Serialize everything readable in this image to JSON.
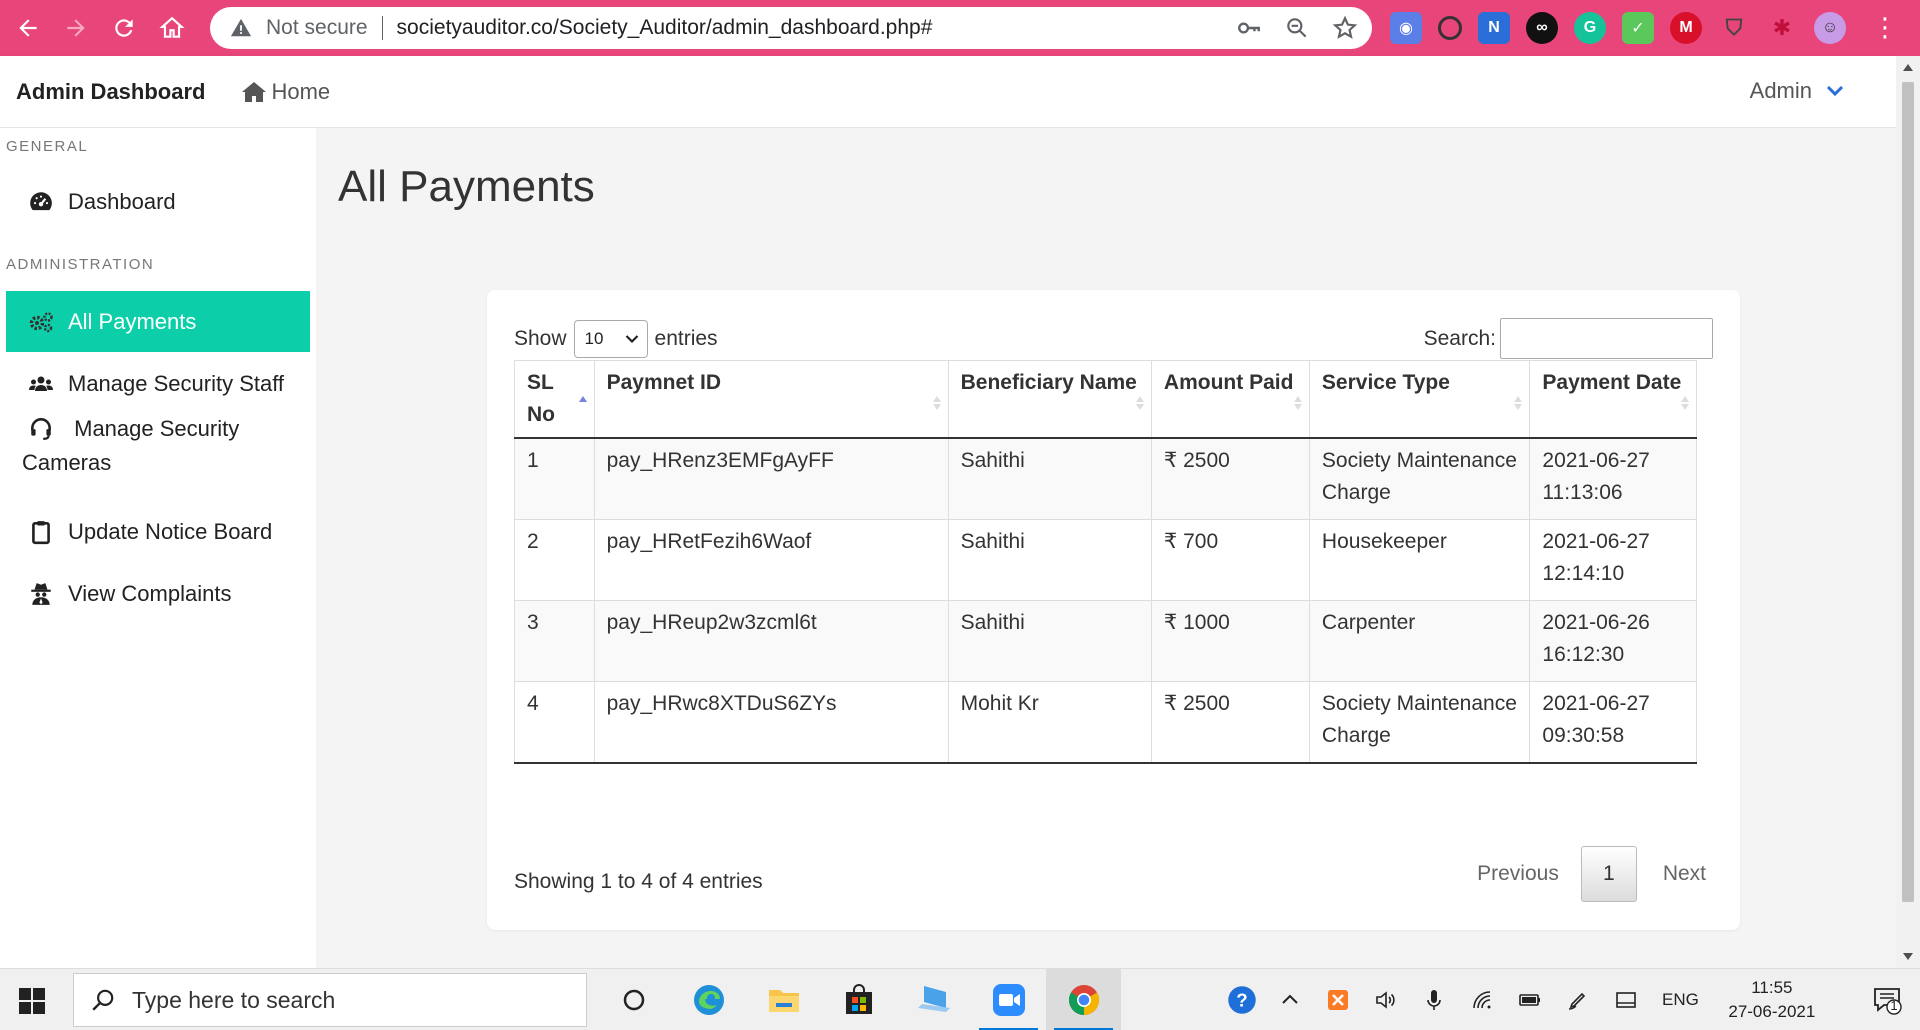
{
  "browser": {
    "security_label": "Not secure",
    "url": "societyauditor.co/Society_Auditor/admin_dashboard.php#",
    "accent_color": "#e8457a"
  },
  "navbar": {
    "brand": "Admin Dashboard",
    "home_label": "Home",
    "user_label": "Admin"
  },
  "sidebar": {
    "general_heading": "GENERAL",
    "admin_heading": "ADMINISTRATION",
    "items": [
      {
        "label": "Dashboard",
        "icon": "dashboard-icon"
      },
      {
        "label": "All Payments",
        "icon": "cogs-icon",
        "active": true
      },
      {
        "label": "Manage Security Staff",
        "icon": "users-icon"
      },
      {
        "label": "Manage Security Cameras",
        "icon": "headset-icon"
      },
      {
        "label": "Update Notice Board",
        "icon": "clipboard-icon"
      },
      {
        "label": "View Complaints",
        "icon": "user-secret-icon"
      }
    ],
    "active_color": "#0ccfa9"
  },
  "main": {
    "title": "All Payments",
    "show_label": "Show",
    "entries_label": "entries",
    "page_length": "10",
    "search_label": "Search:",
    "search_value": "",
    "columns": [
      "SL No",
      "Paymnet ID",
      "Beneficiary Name",
      "Amount Paid",
      "Service Type",
      "Payment Date"
    ],
    "rows": [
      {
        "sl": "1",
        "payment_id": "pay_HRenz3EMFgAyFF",
        "beneficiary": "Sahithi",
        "amount": "₹ 2500",
        "service": "Society Maintenance Charge",
        "date": "2021-06-27 11:13:06"
      },
      {
        "sl": "2",
        "payment_id": "pay_HRetFezih6Waof",
        "beneficiary": "Sahithi",
        "amount": "₹ 700",
        "service": "Housekeeper",
        "date": "2021-06-27 12:14:10"
      },
      {
        "sl": "3",
        "payment_id": "pay_HReup2w3zcml6t",
        "beneficiary": "Sahithi",
        "amount": "₹ 1000",
        "service": "Carpenter",
        "date": "2021-06-26 16:12:30"
      },
      {
        "sl": "4",
        "payment_id": "pay_HRwc8XTDuS6ZYs",
        "beneficiary": "Mohit Kr",
        "amount": "₹ 2500",
        "service": "Society Maintenance Charge",
        "date": "2021-06-27 09:30:58"
      }
    ],
    "info": "Showing 1 to 4 of 4 entries",
    "pagination": {
      "previous": "Previous",
      "current": "1",
      "next": "Next"
    }
  },
  "taskbar": {
    "search_placeholder": "Type here to search",
    "language": "ENG",
    "time": "11:55",
    "date": "27-06-2021",
    "notification_count": "1"
  }
}
